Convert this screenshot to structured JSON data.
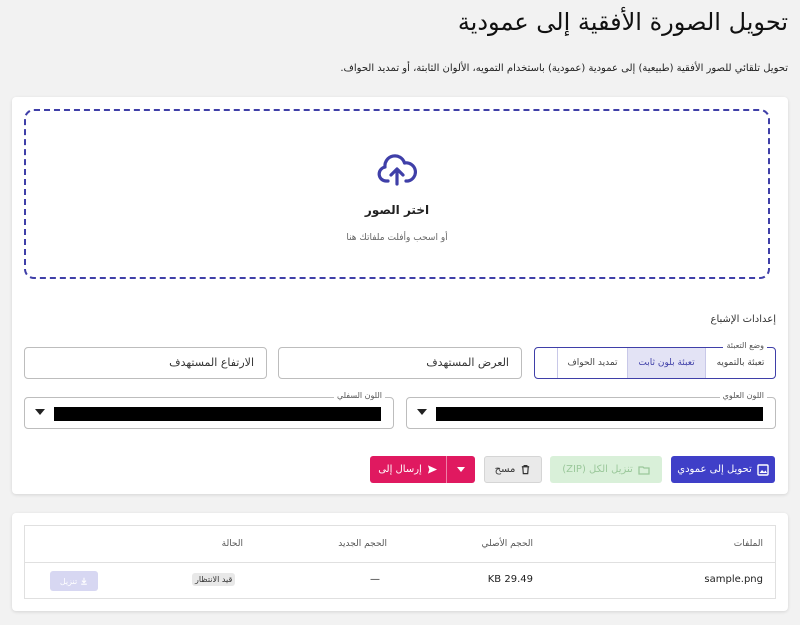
{
  "page": {
    "title": "تحويل الصورة الأفقية إلى عمودية",
    "subtitle": "تحويل تلقائي للصور الأفقية (طبيعية) إلى عمودية (عمودية) باستخدام التمويه، الألوان الثابتة، أو تمديد الحواف."
  },
  "dropzone": {
    "title": "اختر الصور",
    "hint": "أو اسحب وأفلت ملفاتك هنا"
  },
  "settings": {
    "label": "إعدادات الإشباع",
    "mode_legend": "وضع التعبئة",
    "modes": [
      "تعبئة بالتمويه",
      "تعبئة بلون ثابت",
      "تمديد الحواف"
    ],
    "selected_mode": "تعبئة بلون ثابت",
    "target_width_placeholder": "العرض المستهدف",
    "target_height_placeholder": "الارتفاع المستهدف",
    "top_color_label": "اللون العلوي",
    "top_color": "#000000",
    "bottom_color_label": "اللون السفلي",
    "bottom_color": "#000000"
  },
  "actions": {
    "convert": "تحويل إلى عمودي",
    "download_zip": "تنزيل الكل (ZIP)",
    "clear": "مسح",
    "send_to": "إرسال إلى"
  },
  "files_table": {
    "headers": [
      "الملفات",
      "الحجم الأصلي",
      "الحجم الجديد",
      "الحالة"
    ],
    "rows": [
      {
        "name": "sample.png",
        "original_size": "29.49 KB",
        "new_size": "—",
        "status": "قيد الانتظار",
        "download": "تنزيل"
      }
    ]
  },
  "colors": {
    "primary": "#3f3fc8",
    "accent": "#e01960",
    "dashed_border": "#3f3fa8"
  }
}
